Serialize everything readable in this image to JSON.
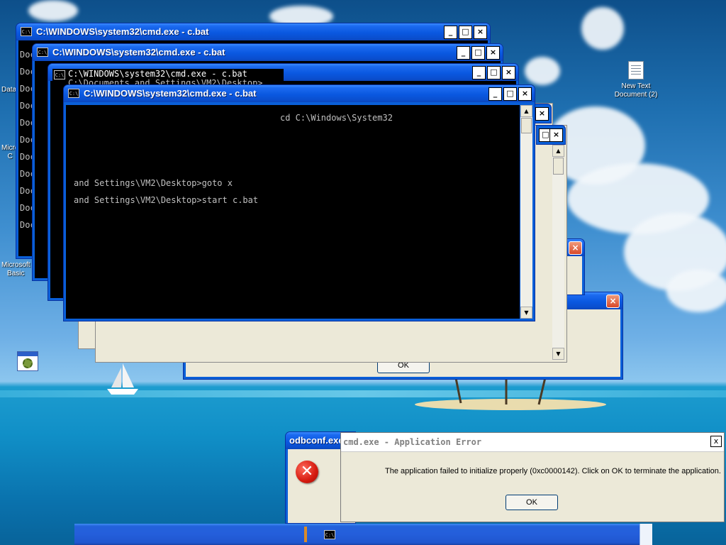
{
  "desktop": {
    "icons": [
      {
        "label": "New Text Document (2)"
      }
    ],
    "partial_labels": [
      "Data",
      "Micro",
      "C",
      "Microsoft",
      "Basic"
    ]
  },
  "cmd_windows": [
    {
      "title": "C:\\WINDOWS\\system32\\cmd.exe - c.bat"
    },
    {
      "title": "C:\\WINDOWS\\system32\\cmd.exe - c.bat"
    },
    {
      "title": "C:\\WINDOWS\\system32\\cmd.exe - c.bat"
    },
    {
      "title": "C:\\WINDOWS\\system32\\cmd.exe - c.bat"
    }
  ],
  "console_left_column": [
    "Docum",
    "Docum",
    "Docum",
    "Docum",
    "Docum",
    "Docum",
    "Docum",
    "Docum",
    "Docum",
    "Docum",
    "Docum"
  ],
  "front_console": {
    "lines": [
      "cd C:\\Windows\\System32",
      "and Settings\\VM2\\Desktop>goto x",
      "and Settings\\VM2\\Desktop>start c.bat"
    ]
  },
  "back_console_overlay": {
    "title_fragment": "C:\\WINDOWS\\system32\\cmd.exe - c.bat",
    "line_fragment": "C:\\Documents and Settings\\VM2\\Desktop>"
  },
  "partial_dialog": {
    "ok_label": "OK"
  },
  "odbc_dialog": {
    "title": "odbconf.exe"
  },
  "error_dialog": {
    "title": "cmd.exe - Application Error",
    "message": "The application failed to initialize properly (0xc0000142). Click on OK to terminate the application.",
    "ok_label": "OK",
    "close_label": "x"
  },
  "icons": {
    "cmd": "cmd-prompt-icon",
    "error": "error-x-icon",
    "close": "close-icon",
    "minimize": "minimize-icon",
    "maximize": "maximize-icon"
  },
  "window_buttons": {
    "minimize": "_",
    "maximize": "□",
    "close": "×"
  },
  "colors": {
    "xp_title": "#0a58e0",
    "console_bg": "#000000",
    "console_text": "#c0c0c0",
    "dialog_face": "#ece9d8",
    "close_red": "#d8482a"
  }
}
